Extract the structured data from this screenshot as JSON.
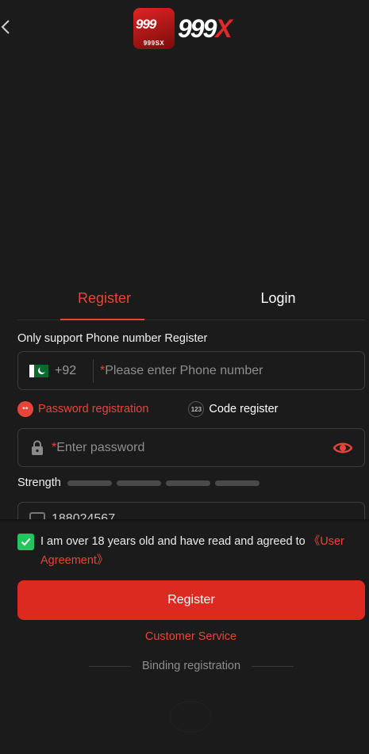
{
  "logo": {
    "badge_top": "999",
    "badge_bottom": "999SX",
    "word_main": "999",
    "word_accent": "X"
  },
  "tabs": [
    {
      "label": "Register",
      "active": true
    },
    {
      "label": "Login",
      "active": false
    }
  ],
  "form": {
    "hint": "Only support Phone number Register",
    "phone": {
      "country_code": "+92",
      "required_mark": "*",
      "placeholder": "Please enter Phone number"
    },
    "methods": {
      "password": {
        "label": "Password registration",
        "icon_text": "**"
      },
      "code": {
        "label": "Code register",
        "icon_text": "123"
      }
    },
    "password": {
      "required_mark": "*",
      "placeholder": "Enter password"
    },
    "strength": {
      "label": "Strength",
      "bars": 4,
      "level": 0
    },
    "referral": {
      "value": "188024567"
    }
  },
  "agreement": {
    "text": "I am over 18 years old and have read and agreed to ",
    "link": "《User Agreement》",
    "checked": true
  },
  "register_button": "Register",
  "customer_service": "Customer Service",
  "binding_text": "Binding registration",
  "colors": {
    "accent": "#e8453a",
    "button": "#dc2a20",
    "checkbox": "#22c55e",
    "background": "#1b1b1b"
  }
}
